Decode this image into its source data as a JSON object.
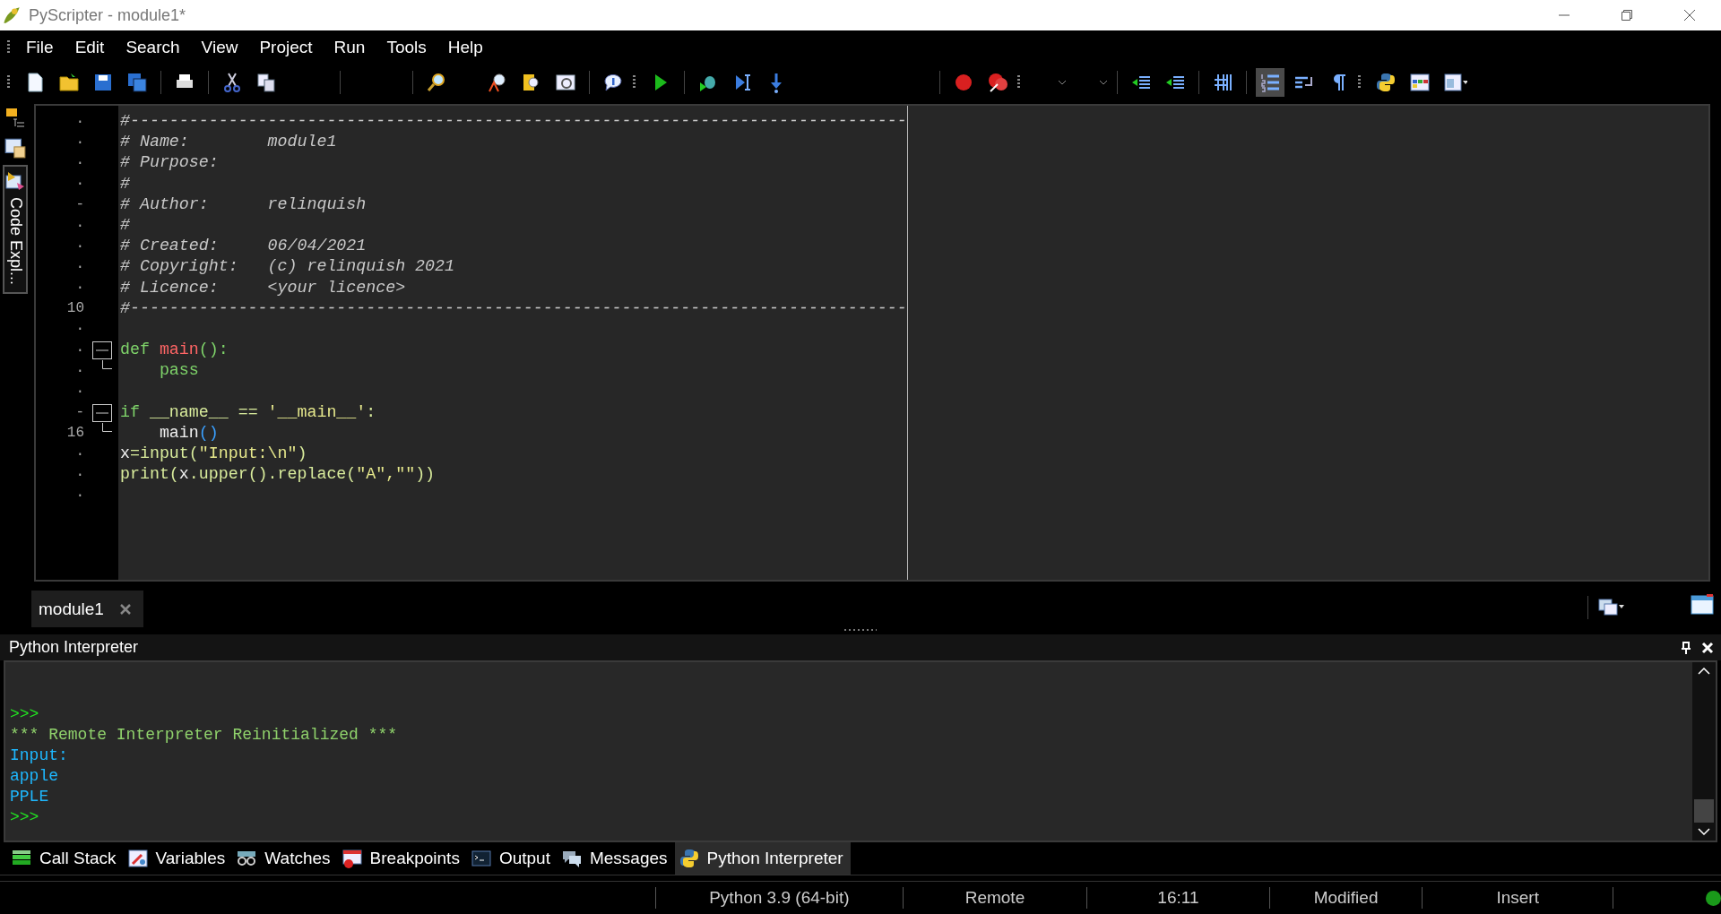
{
  "window": {
    "title": "PyScripter - module1*"
  },
  "menu": [
    "File",
    "Edit",
    "Search",
    "View",
    "Project",
    "Run",
    "Tools",
    "Help"
  ],
  "toolbar": {
    "line_numbers_pressed": true
  },
  "side_tab": {
    "label": "Code Expl...",
    "selected": true
  },
  "editor": {
    "lines": [
      {
        "gutter": "·",
        "tokens": [
          {
            "text": "#-------------------------------------------------------------------------------",
            "kind": "comment"
          }
        ]
      },
      {
        "gutter": "·",
        "tokens": [
          {
            "text": "# Name:        module1",
            "kind": "comment"
          }
        ]
      },
      {
        "gutter": "·",
        "tokens": [
          {
            "text": "# Purpose:",
            "kind": "comment"
          }
        ]
      },
      {
        "gutter": "·",
        "tokens": [
          {
            "text": "#",
            "kind": "comment"
          }
        ]
      },
      {
        "gutter": "-",
        "tokens": [
          {
            "text": "# Author:      relinquish",
            "kind": "comment"
          }
        ]
      },
      {
        "gutter": "·",
        "tokens": [
          {
            "text": "#",
            "kind": "comment"
          }
        ]
      },
      {
        "gutter": "·",
        "tokens": [
          {
            "text": "# Created:     06/04/2021",
            "kind": "comment"
          }
        ]
      },
      {
        "gutter": "·",
        "tokens": [
          {
            "text": "# Copyright:   (c) relinquish 2021",
            "kind": "comment"
          }
        ]
      },
      {
        "gutter": "·",
        "tokens": [
          {
            "text": "# Licence:     <your licence>",
            "kind": "comment"
          }
        ]
      },
      {
        "gutter": "10",
        "tokens": [
          {
            "text": "#-------------------------------------------------------------------------------",
            "kind": "comment"
          }
        ]
      },
      {
        "gutter": "·"
      },
      {
        "gutter": "·",
        "expanded": true,
        "tokens": [
          {
            "text": "def ",
            "kind": "keyword"
          },
          {
            "text": "main",
            "kind": "function"
          },
          {
            "text": "():",
            "kind": "keyword"
          }
        ]
      },
      {
        "gutter": "·",
        "fold_end": true,
        "tokens": [
          {
            "text": "    pass",
            "kind": "keyword"
          }
        ]
      },
      {
        "gutter": "·"
      },
      {
        "gutter": "-",
        "expanded": true,
        "tokens": [
          {
            "text": "if",
            "kind": "keyword"
          },
          {
            "text": " __name__ == ",
            "kind": "identifier"
          },
          {
            "text": "'__main__'",
            "kind": "string"
          },
          {
            "text": ":",
            "kind": "identifier"
          }
        ]
      },
      {
        "gutter": "16",
        "fold_end": true,
        "tokens": [
          {
            "text": "    main",
            "kind": "plain"
          },
          {
            "text": "()",
            "kind": "bracket"
          }
        ]
      },
      {
        "gutter": "·",
        "tokens": [
          {
            "text": "x",
            "kind": "plain"
          },
          {
            "text": "=input(",
            "kind": "identifier"
          },
          {
            "text": "\"Input:\\n\"",
            "kind": "string"
          },
          {
            "text": ")",
            "kind": "identifier"
          }
        ]
      },
      {
        "gutter": "·",
        "tokens": [
          {
            "text": "print(",
            "kind": "identifier"
          },
          {
            "text": "x",
            "kind": "plain"
          },
          {
            "text": ".upper().replace(",
            "kind": "identifier"
          },
          {
            "text": "\"A\",\"\"",
            "kind": "string"
          },
          {
            "text": "))",
            "kind": "identifier"
          }
        ]
      },
      {
        "gutter": "·"
      }
    ]
  },
  "doc_tabs": [
    {
      "label": "module1",
      "selected": true
    }
  ],
  "interpreter": {
    "title": "Python Interpreter",
    "lines": [
      {
        "text": ">>>",
        "kind": "prompt"
      },
      {
        "text": "*** Remote Interpreter Reinitialized ***",
        "kind": "message"
      },
      {
        "text": "Input:",
        "kind": "output"
      },
      {
        "text": "apple",
        "kind": "output"
      },
      {
        "text": "PPLE",
        "kind": "output"
      },
      {
        "text": ">>>",
        "kind": "prompt"
      }
    ]
  },
  "bottom_tabs": [
    {
      "label": "Call Stack",
      "selected": false
    },
    {
      "label": "Variables",
      "selected": false
    },
    {
      "label": "Watches",
      "selected": false
    },
    {
      "label": "Breakpoints",
      "selected": false
    },
    {
      "label": "Output",
      "selected": false
    },
    {
      "label": "Messages",
      "selected": false
    },
    {
      "label": "Python Interpreter",
      "selected": true
    }
  ],
  "status_bar": {
    "cells": [
      "Python 3.9 (64-bit)",
      "Remote",
      "16:11",
      "Modified",
      "Insert"
    ],
    "connected": true
  }
}
